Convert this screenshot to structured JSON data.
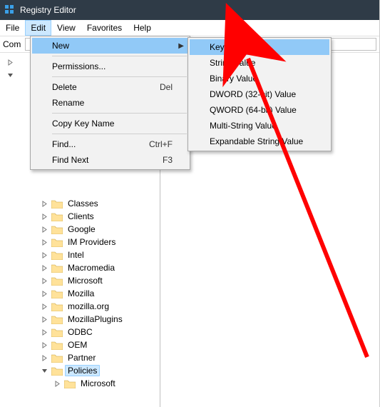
{
  "window": {
    "title": "Registry Editor"
  },
  "menubar": {
    "items": [
      {
        "label": "File"
      },
      {
        "label": "Edit"
      },
      {
        "label": "View"
      },
      {
        "label": "Favorites"
      },
      {
        "label": "Help"
      }
    ],
    "open_index": 1
  },
  "address": {
    "label_prefix": "Com"
  },
  "edit_menu": {
    "new": "New",
    "permissions": "Permissions...",
    "delete": "Delete",
    "delete_shortcut": "Del",
    "rename": "Rename",
    "copy_key_name": "Copy Key Name",
    "find": "Find...",
    "find_shortcut": "Ctrl+F",
    "find_next": "Find Next",
    "find_next_shortcut": "F3"
  },
  "new_submenu": {
    "key": "Key",
    "string_value": "String Value",
    "binary_value": "Binary Value",
    "dword": "DWORD (32-bit) Value",
    "qword": "QWORD (64-bit) Value",
    "multi_string": "Multi-String Value",
    "expandable_string": "Expandable String Value"
  },
  "tree": {
    "top_collapsed": {
      "label": ""
    },
    "top_expanded": {
      "label": ""
    },
    "items": [
      {
        "label": "Classes"
      },
      {
        "label": "Clients"
      },
      {
        "label": "Google"
      },
      {
        "label": "IM Providers"
      },
      {
        "label": "Intel"
      },
      {
        "label": "Macromedia"
      },
      {
        "label": "Microsoft"
      },
      {
        "label": "Mozilla"
      },
      {
        "label": "mozilla.org"
      },
      {
        "label": "MozillaPlugins"
      },
      {
        "label": "ODBC"
      },
      {
        "label": "OEM"
      },
      {
        "label": "Partner"
      }
    ],
    "selected": {
      "label": "Policies"
    },
    "selected_child": {
      "label": "Microsoft"
    }
  },
  "colors": {
    "accent": "#2f3b47",
    "highlight": "#91c9f7",
    "arrow": "#ff0000"
  }
}
